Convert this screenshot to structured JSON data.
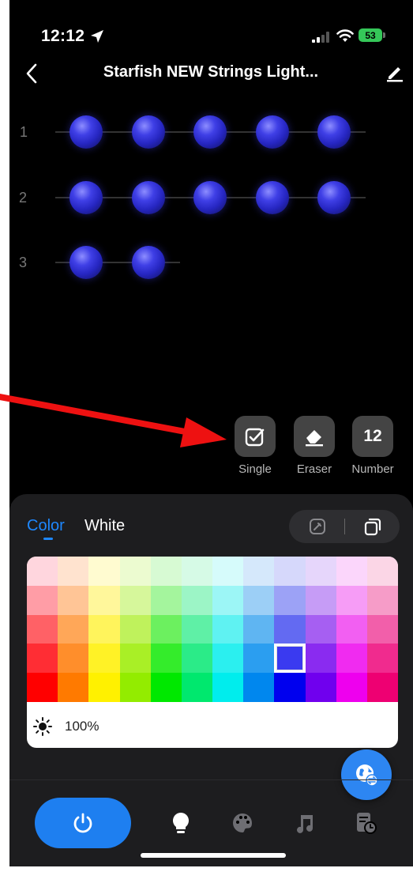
{
  "status_bar": {
    "time": "12:12",
    "battery": "53"
  },
  "header": {
    "title": "Starfish NEW Strings Light..."
  },
  "strings": [
    {
      "label": "1",
      "bulbs": 5
    },
    {
      "label": "2",
      "bulbs": 5
    },
    {
      "label": "3",
      "bulbs": 2
    }
  ],
  "tools": {
    "single_label": "Single",
    "eraser_label": "Eraser",
    "number_label": "Number",
    "number_value": "12"
  },
  "panel": {
    "tab_color": "Color",
    "tab_white": "White",
    "brightness": "100%",
    "selected_color": "#3a3af0",
    "palette": [
      [
        "#ffd6de",
        "#ffe3cf",
        "#fffbd0",
        "#ecfbd0",
        "#d7fad3",
        "#d6fae6",
        "#d6fbfb",
        "#d5e8fb",
        "#d6d8fb",
        "#e6d6fb",
        "#fbd6fb",
        "#fbd6e6"
      ],
      [
        "#ff9da6",
        "#ffc596",
        "#fff79b",
        "#d6f79b",
        "#a4f59d",
        "#9cf5c6",
        "#9cf6f6",
        "#9ccff6",
        "#9ca2f6",
        "#c69cf6",
        "#f69cf6",
        "#f69cc8"
      ],
      [
        "#ff6166",
        "#ffa758",
        "#fff45c",
        "#bff25c",
        "#6cf05f",
        "#5ff0a6",
        "#5ff2f2",
        "#5fb5f2",
        "#636af2",
        "#a65ff2",
        "#f25ff2",
        "#f25faa"
      ],
      [
        "#ff2d34",
        "#ff8e2b",
        "#fff226",
        "#a9ef26",
        "#34ec2b",
        "#2beb88",
        "#2befef",
        "#2b9ef0",
        "#3a3af0",
        "#8a2bf0",
        "#f02bf0",
        "#f02b8e"
      ],
      [
        "#ff0000",
        "#ff7a00",
        "#fff100",
        "#93ec00",
        "#00e800",
        "#00e86e",
        "#00eded",
        "#0087ee",
        "#0000ee",
        "#7000ee",
        "#ee00ee",
        "#ee0072"
      ]
    ],
    "selected_cell": [
      3,
      8
    ]
  },
  "accent_color": "#1e7ff0",
  "icons": [
    "location-arrow-icon",
    "signal-icon",
    "wifi-icon",
    "back-icon",
    "edit-icon",
    "check-square-icon",
    "eraser-icon",
    "color-mode-icon",
    "copy-mode-icon",
    "sun-icon",
    "globe-swap-icon",
    "power-icon",
    "bulb-icon",
    "palette-icon",
    "music-icon",
    "schedule-icon"
  ]
}
